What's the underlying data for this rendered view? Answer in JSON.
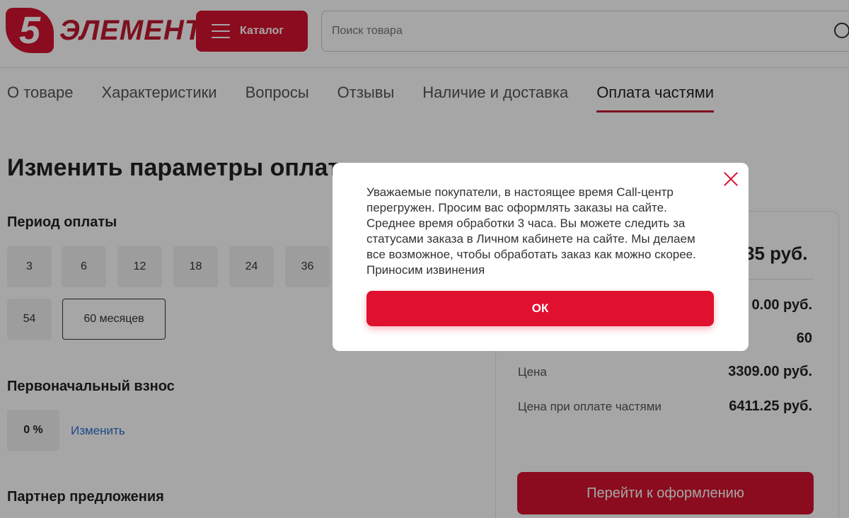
{
  "header": {
    "logo_digit": "5",
    "logo_text": "ЭЛЕМЕНТ",
    "catalog_label": "Каталог",
    "search_placeholder": "Поиск товара"
  },
  "tabs": [
    {
      "label": "О товаре"
    },
    {
      "label": "Характеристики"
    },
    {
      "label": "Вопросы"
    },
    {
      "label": "Отзывы"
    },
    {
      "label": "Наличие и доставка"
    },
    {
      "label": "Оплата частями",
      "active": true
    }
  ],
  "main": {
    "title": "Изменить параметры оплаты",
    "period_label": "Период оплаты",
    "periods": [
      "3",
      "6",
      "12",
      "18",
      "24",
      "36",
      "54",
      "60 месяцев"
    ],
    "downpayment_label": "Первоначальный взнос",
    "downpayment_value": "0 %",
    "change_link": "Изменить",
    "partner_label": "Партнер предложения"
  },
  "summary": {
    "monthly_payment": "35 руб.",
    "row1_value": "0.00 руб.",
    "row2_value": "60",
    "price_label": "Цена",
    "price_value": "3309.00 руб.",
    "installment_price_label": "Цена при оплате частями",
    "installment_price_value": "6411.25 руб.",
    "checkout_label": "Перейти к оформлению"
  },
  "modal": {
    "message": "Уважаемые покупатели, в настоящее время Call-центр перегружен. Просим вас оформлять заказы на сайте. Среднее время обработки 3 часа. Вы можете следить за статусами заказа в Личном кабинете на сайте. Мы делаем все возможное, чтобы обработать заказ как можно скорее. Приносим извинения",
    "ok_label": "ОК"
  },
  "colors": {
    "brand_red": "#d5132f",
    "link_blue": "#2d6fcf"
  }
}
